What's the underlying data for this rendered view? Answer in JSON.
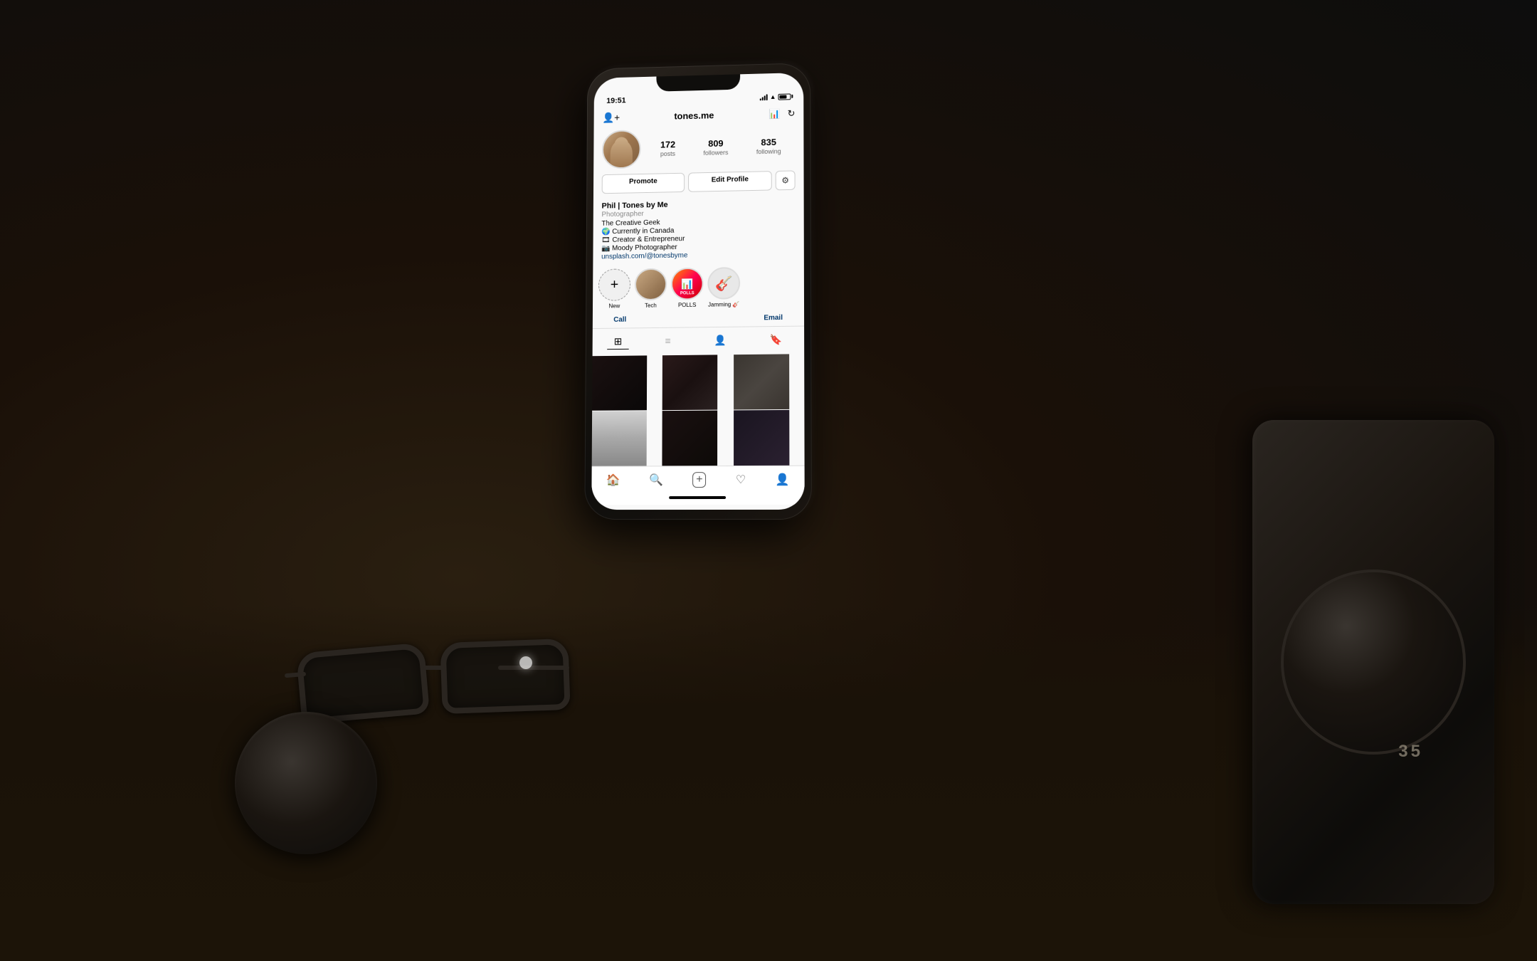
{
  "scene": {
    "background_color": "#1a1008"
  },
  "phone": {
    "status_bar": {
      "time": "19:51"
    },
    "header": {
      "username": "tones.me",
      "add_friend_icon": "add-person-icon",
      "bar_chart_icon": "bar-chart-icon",
      "history_icon": "history-icon"
    },
    "profile": {
      "stats": [
        {
          "number": "172",
          "label": "posts"
        },
        {
          "number": "809",
          "label": "followers"
        },
        {
          "number": "835",
          "label": "following"
        }
      ],
      "buttons": {
        "promote": "Promote",
        "edit": "Edit Profile"
      },
      "name": "Phil | Tones by Me",
      "category": "Photographer",
      "bio_lines": [
        "The Creative Geek",
        "🌍 Currently in Canada",
        "🎞 Creator & Entrepreneur",
        "📷 Moody Photographer"
      ],
      "link": "unsplash.com/@tonesbyme"
    },
    "stories": [
      {
        "label": "New",
        "type": "new"
      },
      {
        "label": "Tech",
        "type": "tech"
      },
      {
        "label": "POLLS",
        "type": "polls"
      },
      {
        "label": "Jamming 🎸",
        "type": "jamming"
      }
    ],
    "actions": {
      "call": "Call",
      "email": "Email"
    },
    "nav": {
      "home": "home",
      "search": "search",
      "add": "add",
      "heart": "heart",
      "profile": "profile"
    }
  }
}
